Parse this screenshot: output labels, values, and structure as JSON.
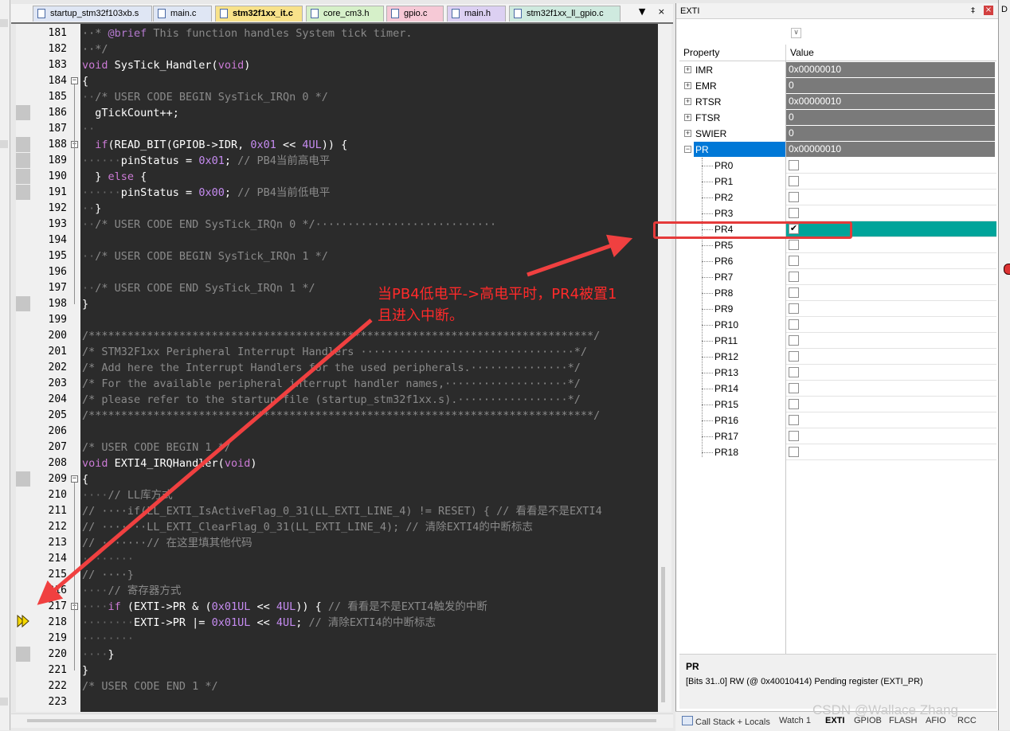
{
  "tabs": [
    {
      "label": "startup_stm32f103xb.s",
      "color": "#dfe6f4",
      "active": false
    },
    {
      "label": "main.c",
      "color": "#dfe6f4",
      "active": false
    },
    {
      "label": "stm32f1xx_it.c",
      "color": "#f8e28a",
      "active": true
    },
    {
      "label": "core_cm3.h",
      "color": "#d6f0c9",
      "active": false
    },
    {
      "label": "gpio.c",
      "color": "#f6c9d6",
      "active": false
    },
    {
      "label": "main.h",
      "color": "#dcd0f2",
      "active": false
    },
    {
      "label": "stm32f1xx_ll_gpio.c",
      "color": "#cfeadf",
      "active": false
    }
  ],
  "tab_controls": "▼ ×",
  "line_numbers": [
    "181",
    "182",
    "183",
    "184",
    "185",
    "186",
    "187",
    "188",
    "189",
    "190",
    "191",
    "192",
    "193",
    "194",
    "195",
    "196",
    "197",
    "198",
    "199",
    "200",
    "201",
    "202",
    "203",
    "204",
    "205",
    "206",
    "207",
    "208",
    "209",
    "210",
    "211",
    "212",
    "213",
    "214",
    "215",
    "216",
    "217",
    "218",
    "219",
    "220",
    "221",
    "222",
    "223"
  ],
  "code_lines": [
    "··* @brief This function handles System tick timer.",
    "··*/",
    "void SysTick_Handler(void)",
    "{",
    "··/* USER CODE BEGIN SysTick_IRQn 0 */",
    "  gTickCount++;",
    "··",
    "  if(READ_BIT(GPIOB->IDR, 0x01 << 4UL)) {",
    "······pinStatus = 0x01; // PB4当前高电平",
    "  } else {",
    "······pinStatus = 0x00; // PB4当前低电平",
    "··}",
    "··/* USER CODE END SysTick_IRQn 0 */····························",
    "",
    "··/* USER CODE BEGIN SysTick_IRQn 1 */",
    "",
    "··/* USER CODE END SysTick_IRQn 1 */",
    "}",
    "",
    "/******************************************************************************/",
    "/* STM32F1xx Peripheral Interrupt Handlers ·································*/",
    "/* Add here the Interrupt Handlers for the used peripherals.···············*/",
    "/* For the available peripheral interrupt handler names,···················*/",
    "/* please refer to the startup file (startup_stm32f1xx.s).·················*/",
    "/******************************************************************************/",
    "",
    "/* USER CODE BEGIN 1 */",
    "void EXTI4_IRQHandler(void)",
    "{",
    "····// LL库方式",
    "// ····if(LL_EXTI_IsActiveFlag_0_31(LL_EXTI_LINE_4) != RESET) { // 看看是不是EXTI4",
    "// ·······LL_EXTI_ClearFlag_0_31(LL_EXTI_LINE_4); // 清除EXTI4的中断标志",
    "// ·······// 在这里填其他代码",
    "········",
    "// ····}",
    "····// 寄存器方式",
    "····if (EXTI->PR & (0x01UL << 4UL)) { // 看看是不是EXTI4触发的中断",
    "········EXTI->PR |= 0x01UL << 4UL; // 清除EXTI4的中断标志",
    "········",
    "····}",
    "}",
    "/* USER CODE END 1 */",
    ""
  ],
  "panel": {
    "title": "EXTI",
    "pin": "‡",
    "close": "×",
    "dropdown": "∨",
    "col_property": "Property",
    "col_value": "Value",
    "registers": [
      {
        "name": "IMR",
        "value": "0x00000010",
        "expander": "+"
      },
      {
        "name": "EMR",
        "value": "0",
        "expander": "+"
      },
      {
        "name": "RTSR",
        "value": "0x00000010",
        "expander": "+"
      },
      {
        "name": "FTSR",
        "value": "0",
        "expander": "+"
      },
      {
        "name": "SWIER",
        "value": "0",
        "expander": "+"
      },
      {
        "name": "PR",
        "value": "0x00000010",
        "expander": "−",
        "selected": true
      }
    ],
    "pr_bits": [
      {
        "name": "PR0",
        "checked": false
      },
      {
        "name": "PR1",
        "checked": false
      },
      {
        "name": "PR2",
        "checked": false
      },
      {
        "name": "PR3",
        "checked": false
      },
      {
        "name": "PR4",
        "checked": true
      },
      {
        "name": "PR5",
        "checked": false
      },
      {
        "name": "PR6",
        "checked": false
      },
      {
        "name": "PR7",
        "checked": false
      },
      {
        "name": "PR8",
        "checked": false
      },
      {
        "name": "PR9",
        "checked": false
      },
      {
        "name": "PR10",
        "checked": false
      },
      {
        "name": "PR11",
        "checked": false
      },
      {
        "name": "PR12",
        "checked": false
      },
      {
        "name": "PR13",
        "checked": false
      },
      {
        "name": "PR14",
        "checked": false
      },
      {
        "name": "PR15",
        "checked": false
      },
      {
        "name": "PR16",
        "checked": false
      },
      {
        "name": "PR17",
        "checked": false
      },
      {
        "name": "PR18",
        "checked": false
      }
    ],
    "checkmark": "✔",
    "desc_title": "PR",
    "desc_text": "[Bits 31..0] RW (@ 0x40010414) Pending register (EXTI_PR)"
  },
  "bottom_tabs": [
    {
      "label": "Call Stack + Locals",
      "active": false
    },
    {
      "label": "Watch 1",
      "active": false
    },
    {
      "label": "EXTI",
      "active": true
    },
    {
      "label": "GPIOB",
      "active": false
    },
    {
      "label": "FLASH",
      "active": false
    },
    {
      "label": "AFIO",
      "active": false
    },
    {
      "label": "RCC",
      "active": false
    }
  ],
  "right_strip_label": "D",
  "annotation": {
    "text_line1": "当PB4低电平->高电平时，PR4被置1",
    "text_line2": "且进入中断。",
    "color": "#f04040"
  },
  "watermark": "CSDN @Wallace Zhang",
  "colors": {
    "editor_bg": "#2b2b2b",
    "selection_blue": "#0078d7",
    "highlight_teal": "#00a49a",
    "register_value_bg": "#7a7a7a"
  }
}
